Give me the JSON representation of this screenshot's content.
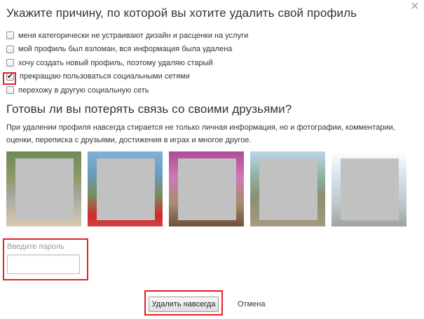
{
  "dialog": {
    "close_icon": "close-icon",
    "title": "Укажите причину, по которой вы хотите удалить свой профиль"
  },
  "reasons": [
    {
      "label": "меня категорически не устраивают дизайн и расценки на услуги",
      "checked": false
    },
    {
      "label": "мой профиль был взломан, вся информация была удалена",
      "checked": false
    },
    {
      "label": "хочу создать новый профиль, поэтому удаляю старый",
      "checked": false
    },
    {
      "label": "прекращаю пользоваться социальными сетями",
      "checked": true
    },
    {
      "label": "перехожу в другую социальную сеть",
      "checked": false
    }
  ],
  "friends": {
    "heading": "Готовы ли вы потерять связь со своими друзьями?",
    "description": "При удалении профиля навсегда стирается не только личная информация, но и фотографии, комментарии, оценки, переписка с друзьями, достижения в играх и многое другое.",
    "photos_count": 5
  },
  "password": {
    "label": "Введите пароль",
    "value": ""
  },
  "actions": {
    "delete_label": "Удалить навсегда",
    "cancel_label": "Отмена"
  },
  "colors": {
    "highlight": "#e3202e",
    "text": "#333333",
    "placeholder": "#999999"
  }
}
